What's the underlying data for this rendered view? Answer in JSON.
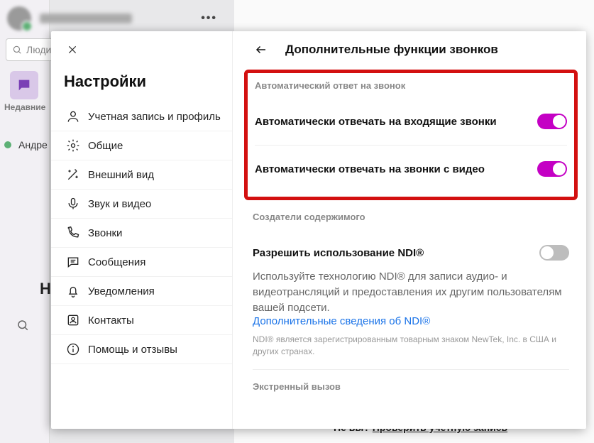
{
  "bg": {
    "search_placeholder": "Люди",
    "recent_label": "Недавние",
    "contact_name": "Андре",
    "page_title": "На",
    "not_you_prefix": "Не вы? ",
    "not_you_link": "Проверить учетную запись"
  },
  "more": "•••",
  "settings": {
    "title": "Настройки",
    "nav": [
      {
        "label": "Учетная запись и профиль"
      },
      {
        "label": "Общие"
      },
      {
        "label": "Внешний вид"
      },
      {
        "label": "Звук и видео"
      },
      {
        "label": "Звонки"
      },
      {
        "label": "Сообщения"
      },
      {
        "label": "Уведомления"
      },
      {
        "label": "Контакты"
      },
      {
        "label": "Помощь и отзывы"
      }
    ]
  },
  "content": {
    "title": "Дополнительные функции звонков",
    "section_auto_answer": "Автоматический ответ на звонок",
    "row_auto_incoming": "Автоматически отвечать на входящие звонки",
    "row_auto_video": "Автоматически отвечать на звонки с видео",
    "section_creators": "Создатели содержимого",
    "row_ndi": "Разрешить использование NDI®",
    "ndi_desc": "Используйте технологию NDI® для записи аудио- и видеотрансляций и предоставления их другим пользователям вашей подсети.",
    "ndi_link": "Дополнительные сведения об NDI®",
    "ndi_fine": "NDI® является зарегистрированным товарным знаком NewTek, Inc. в США и других странах.",
    "section_emergency": "Экстренный вызов"
  }
}
